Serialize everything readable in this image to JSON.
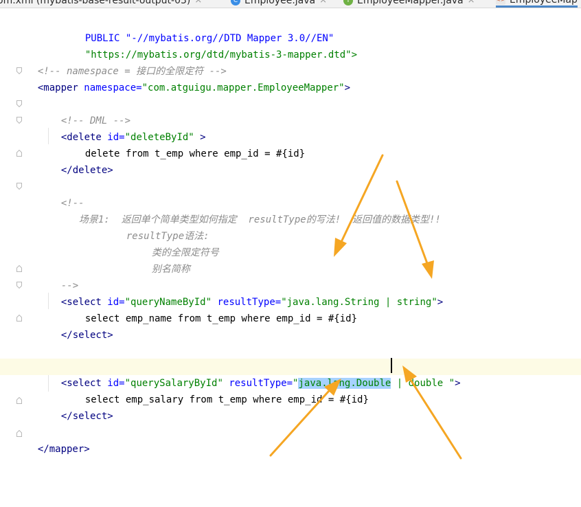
{
  "tabs": [
    {
      "label": "om.xml (mybatis-base-result-output-03)",
      "icon": "maven-file-icon",
      "active": false
    },
    {
      "label": "Employee.java",
      "icon": "class-icon",
      "active": false
    },
    {
      "label": "EmployeeMapper.java",
      "icon": "interface-icon",
      "active": false
    },
    {
      "label": "EmployeeMap",
      "icon": "xml-file-icon",
      "active": true
    }
  ],
  "tab_close_glyph": "×",
  "tab_icon_text": {
    "class": "C",
    "interface": "I",
    "xml": "<>"
  },
  "code": {
    "l1": "PUBLIC \"-//mybatis.org//DTD Mapper 3.0//EN\"",
    "l2": "\"https://mybatis.org/dtd/mybatis-3-mapper.dtd\">",
    "l3": "<!-- namespace = 接口的全限定符 -->",
    "l4_tag_open": "<mapper",
    "l4_attr": " namespace=",
    "l4_val": "\"com.atguigu.mapper.EmployeeMapper\"",
    "l4_close": ">",
    "l5": "<!-- DML -->",
    "l6_tag_open": "<delete",
    "l6_attr": " id=",
    "l6_val": "\"deleteById\"",
    "l6_close": " >",
    "l7": "delete from t_emp where emp_id = #{id}",
    "l8": "</delete>",
    "l9": "<!--",
    "l10": "场景1:  返回单个简单类型如何指定  resultType的写法!  返回值的数据类型!!",
    "l11": "resultType语法:",
    "l12": "类的全限定符号",
    "l13": "别名简称",
    "l14": "-->",
    "l15_tag_open": "<select",
    "l15_attr1": " id=",
    "l15_val1": "\"queryNameById\"",
    "l15_attr2": " resultType=",
    "l15_val2": "\"java.lang.String | string\"",
    "l15_close": ">",
    "l16": "select emp_name from t_emp where emp_id = #{id}",
    "l17": "</select>",
    "l18_tag_open": "<select",
    "l18_attr1": " id=",
    "l18_val1": "\"querySalaryById\"",
    "l18_attr2": " resultType=",
    "l18_val2_a": "\"",
    "l18_val2_sel": "java.lang.Double",
    "l18_val2_b": " | double \"",
    "l18_close": ">",
    "l19": "select emp_salary from t_emp where emp_id = #{id}",
    "l20": "</select>",
    "l21": "</mapper>"
  },
  "colors": {
    "tag": "#000080",
    "attribute": "#0000ff",
    "string": "#008000",
    "comment": "#8c8c8c",
    "selection": "#a6d2ff",
    "current_line": "#fdfbe5",
    "annotation_arrow": "#f5a623"
  }
}
